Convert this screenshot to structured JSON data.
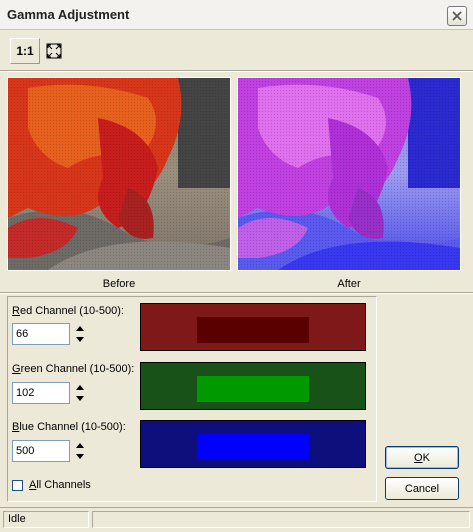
{
  "window": {
    "title": "Gamma Adjustment"
  },
  "toolbar": {
    "actual_size_label": "1:1",
    "fit_icon": "fit-to-window-icon",
    "close_icon": "close-icon"
  },
  "images": {
    "before_caption": "Before",
    "after_caption": "After"
  },
  "channels": {
    "red": {
      "mnemonic": "R",
      "label_rest": "ed Channel (10-500):",
      "value": "66",
      "preview_outer": "#8c1a1a",
      "preview_inner": "#5a0000"
    },
    "green": {
      "mnemonic": "G",
      "label_rest": "reen Channel (10-500):",
      "value": "102",
      "preview_outer": "#1a5a1a",
      "preview_inner": "#009900"
    },
    "blue": {
      "mnemonic": "B",
      "label_rest": "lue Channel (10-500):",
      "value": "500",
      "preview_outer": "#10108a",
      "preview_inner": "#0000ff"
    }
  },
  "all_channels": {
    "mnemonic": "A",
    "label_rest": "ll Channels",
    "checked": false
  },
  "buttons": {
    "ok_mnemonic": "O",
    "ok_rest": "K",
    "cancel_label": "Cancel"
  },
  "status": {
    "text": "Idle"
  },
  "colors": {
    "face": "#ece9d8",
    "input_border": "#7f9db9",
    "button_border": "#003c74"
  }
}
